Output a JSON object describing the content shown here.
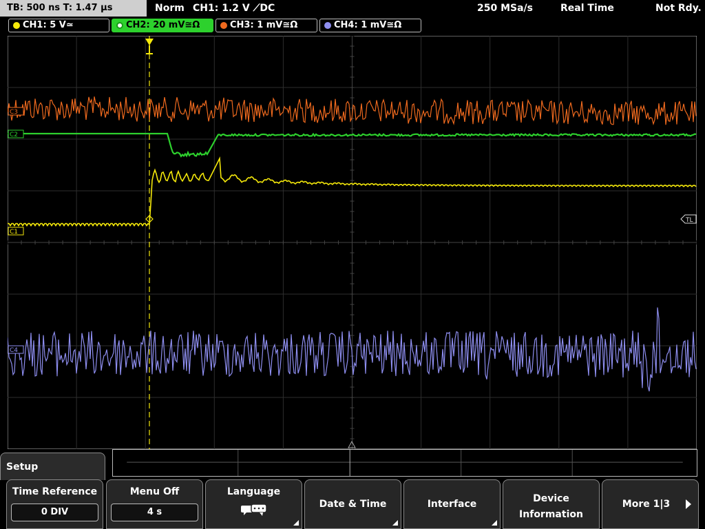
{
  "topbar": {
    "timebase": "TB: 500 ns   T: 1.47 µs",
    "mode": "Norm",
    "trigger": "CH1: 1.2 V ⟋DC",
    "sample_rate": "250 MSa/s",
    "acq_mode": "Real Time",
    "status": "Not Rdy."
  },
  "channels": [
    {
      "label": "CH1: 5 V≃",
      "color": "#f5e90a"
    },
    {
      "label": "CH2: 20 mV≅Ω",
      "color": "#2dd12d"
    },
    {
      "label": "CH3: 1 mV≅Ω",
      "color": "#f06a1e"
    },
    {
      "label": "CH4: 1 mV≅Ω",
      "color": "#8e8ef0"
    }
  ],
  "markers": {
    "ch3": "C3",
    "ch2": "C2",
    "ch1": "C1",
    "ch4": "C4",
    "trigger_level": "TL"
  },
  "menu": {
    "title": "Setup",
    "softkeys": [
      {
        "label": "Time Reference",
        "value": "0 DIV"
      },
      {
        "label": "Menu Off",
        "value": "4 s"
      },
      {
        "label": "Language",
        "icon": "speech-bubbles-icon"
      },
      {
        "label": "Date & Time"
      },
      {
        "label": "Interface"
      },
      {
        "label_line1": "Device",
        "label_line2": "Information"
      },
      {
        "label": "More 1|3"
      }
    ]
  }
}
